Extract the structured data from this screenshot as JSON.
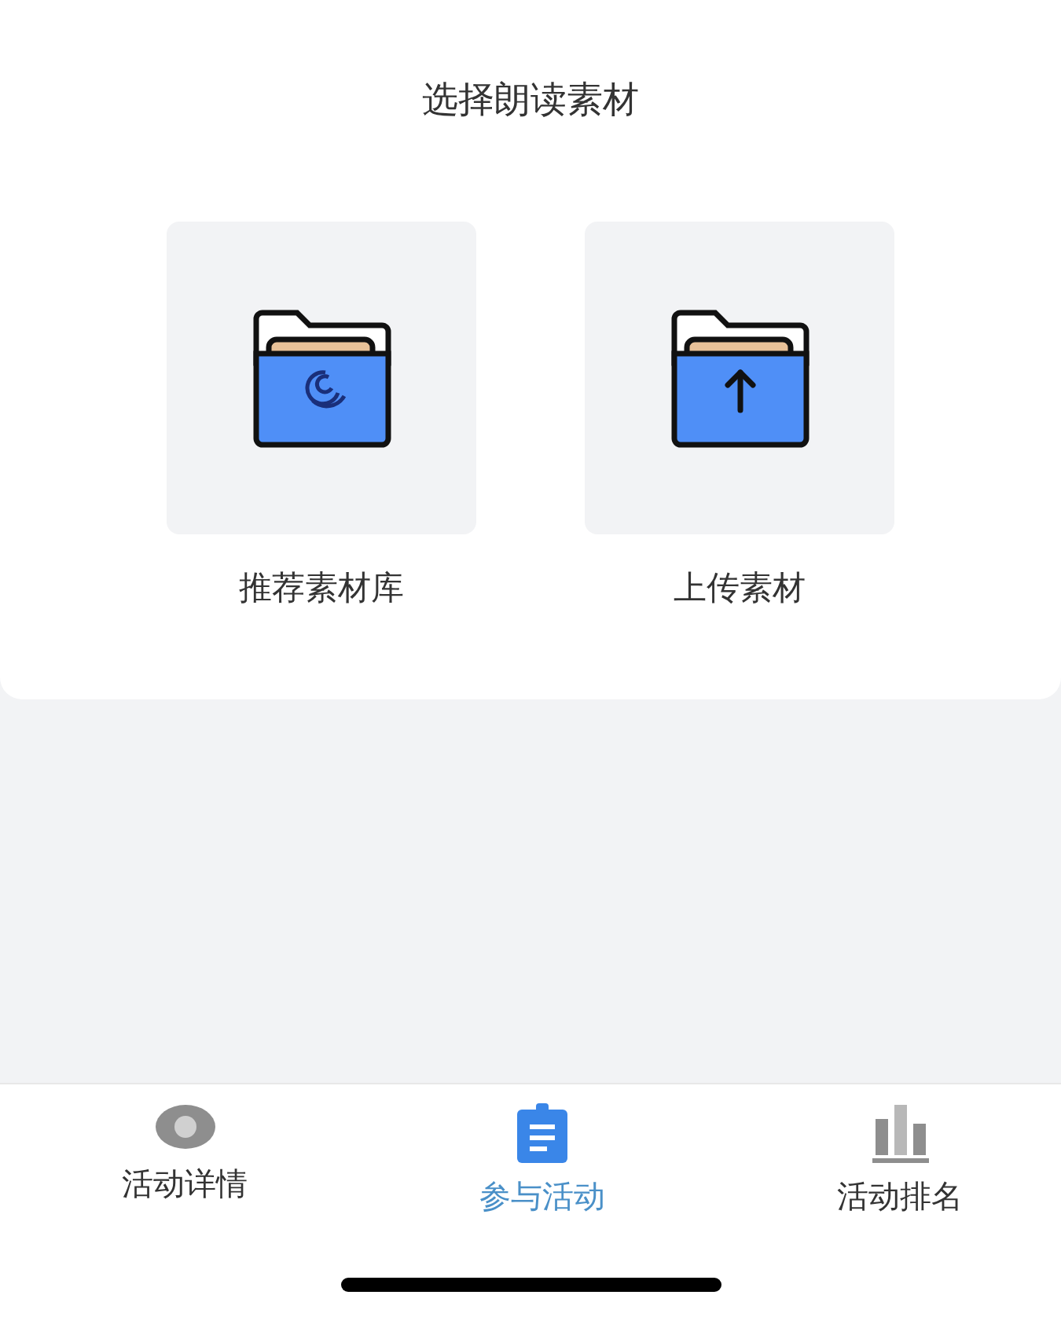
{
  "title": "选择朗读素材",
  "options": [
    {
      "kind": "library",
      "label": "推荐素材库"
    },
    {
      "kind": "upload",
      "label": "上传素材"
    }
  ],
  "tabs": [
    {
      "kind": "details",
      "label": "活动详情",
      "selected": false
    },
    {
      "kind": "join",
      "label": "参与活动",
      "selected": true
    },
    {
      "kind": "ranking",
      "label": "活动排名",
      "selected": false
    }
  ]
}
